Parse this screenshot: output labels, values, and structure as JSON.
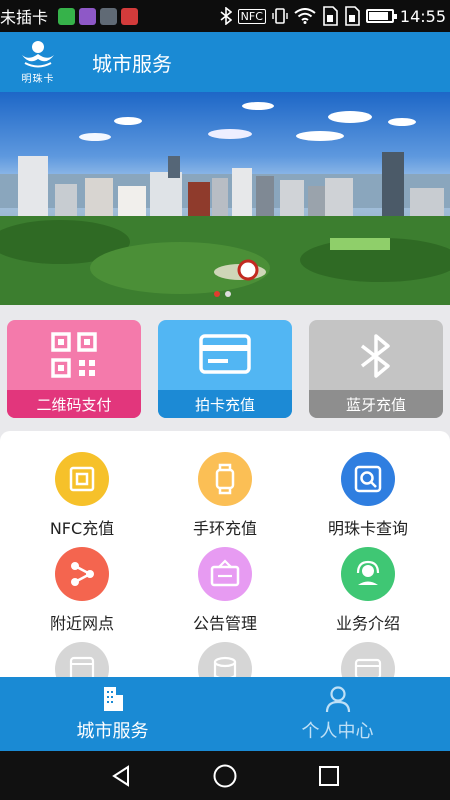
{
  "status_bar": {
    "carrier": "未插卡",
    "nfc_label": "NFC",
    "time": "14:55",
    "battery_level": 0.85
  },
  "header": {
    "logo_text": "明珠卡",
    "title": "城市服务"
  },
  "banner": {
    "slide_count": 2,
    "active_slide": 1
  },
  "quick_actions": [
    {
      "label": "二维码支付",
      "icon": "qr-code-icon",
      "color": "#e2367c"
    },
    {
      "label": "拍卡充值",
      "icon": "card-icon",
      "color": "#1c8ad5"
    },
    {
      "label": "蓝牙充值",
      "icon": "bluetooth-icon",
      "color": "#8e8e8e"
    }
  ],
  "services": [
    {
      "label": "NFC充值",
      "icon": "nfc-icon",
      "color": "#f6c12a"
    },
    {
      "label": "手环充值",
      "icon": "watch-icon",
      "color": "#fbbf55"
    },
    {
      "label": "明珠卡查询",
      "icon": "card-search-icon",
      "color": "#2f7ee0"
    },
    {
      "label": "附近网点",
      "icon": "share-nodes-icon",
      "color": "#f4654f"
    },
    {
      "label": "公告管理",
      "icon": "notice-board-icon",
      "color": "#e79bf2"
    },
    {
      "label": "业务介绍",
      "icon": "customer-service-icon",
      "color": "#3fc774"
    },
    {
      "label": "",
      "icon": "diy-icon",
      "color": "#d6d6d6"
    },
    {
      "label": "",
      "icon": "database-icon",
      "color": "#d6d6d6"
    },
    {
      "label": "",
      "icon": "card-icon",
      "color": "#d6d6d6"
    }
  ],
  "tabs": [
    {
      "label": "城市服务",
      "icon": "building-icon",
      "active": true
    },
    {
      "label": "个人中心",
      "icon": "person-icon",
      "active": false
    }
  ],
  "nav_bar": {
    "back": "back-icon",
    "home": "home-icon",
    "recents": "recents-icon"
  }
}
